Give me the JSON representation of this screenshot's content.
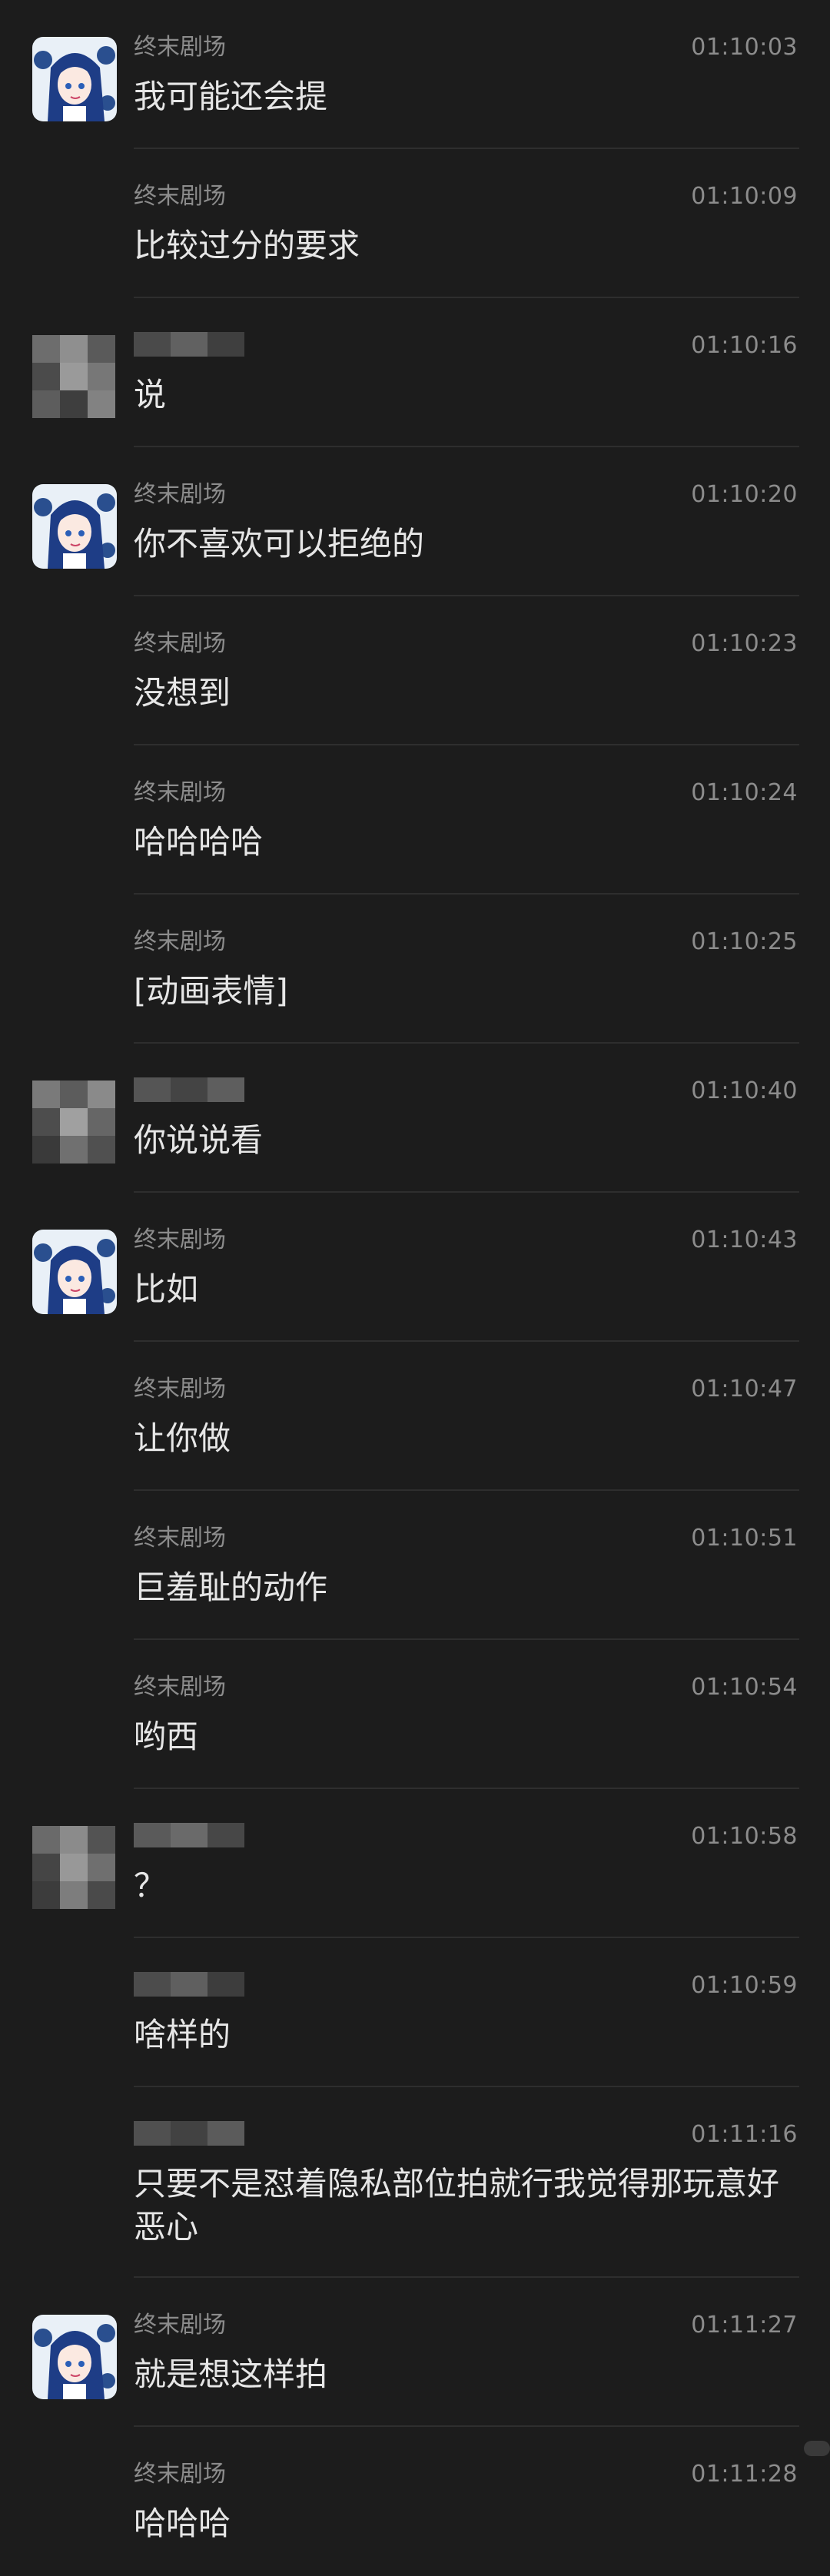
{
  "messages": [
    {
      "sender": "终末剧场",
      "time": "01:10:03",
      "text": "我可能还会提",
      "avatar": "anime",
      "sender_hidden": false
    },
    {
      "sender": "终末剧场",
      "time": "01:10:09",
      "text": "比较过分的要求",
      "avatar": "none",
      "sender_hidden": false
    },
    {
      "sender": "",
      "time": "01:10:16",
      "text": "说",
      "avatar": "mosaic",
      "sender_hidden": true
    },
    {
      "sender": "终末剧场",
      "time": "01:10:20",
      "text": "你不喜欢可以拒绝的",
      "avatar": "anime",
      "sender_hidden": false
    },
    {
      "sender": "终末剧场",
      "time": "01:10:23",
      "text": "没想到",
      "avatar": "none",
      "sender_hidden": false
    },
    {
      "sender": "终末剧场",
      "time": "01:10:24",
      "text": "哈哈哈哈",
      "avatar": "none",
      "sender_hidden": false
    },
    {
      "sender": "终末剧场",
      "time": "01:10:25",
      "text": "[动画表情]",
      "avatar": "none",
      "sender_hidden": false
    },
    {
      "sender": "",
      "time": "01:10:40",
      "text": "你说说看",
      "avatar": "mosaic",
      "sender_hidden": true
    },
    {
      "sender": "终末剧场",
      "time": "01:10:43",
      "text": "比如",
      "avatar": "anime",
      "sender_hidden": false
    },
    {
      "sender": "终末剧场",
      "time": "01:10:47",
      "text": "让你做",
      "avatar": "none",
      "sender_hidden": false
    },
    {
      "sender": "终末剧场",
      "time": "01:10:51",
      "text": "巨羞耻的动作",
      "avatar": "none",
      "sender_hidden": false
    },
    {
      "sender": "终末剧场",
      "time": "01:10:54",
      "text": "哟西",
      "avatar": "none",
      "sender_hidden": false
    },
    {
      "sender": "",
      "time": "01:10:58",
      "text": "？",
      "avatar": "mosaic",
      "sender_hidden": true
    },
    {
      "sender": "",
      "time": "01:10:59",
      "text": "啥样的",
      "avatar": "none",
      "sender_hidden": true
    },
    {
      "sender": "",
      "time": "01:11:16",
      "text": "只要不是怼着隐私部位拍就行我觉得那玩意好恶心",
      "avatar": "none",
      "sender_hidden": true
    },
    {
      "sender": "终末剧场",
      "time": "01:11:27",
      "text": "就是想这样拍",
      "avatar": "anime",
      "sender_hidden": false
    },
    {
      "sender": "终末剧场",
      "time": "01:11:28",
      "text": "哈哈哈",
      "avatar": "none",
      "sender_hidden": false
    }
  ],
  "colors": {
    "background": "#1c1c1c",
    "meta_text": "#8c8c8c",
    "body_text": "#e6e6e6",
    "divider": "#2e2e2e"
  }
}
